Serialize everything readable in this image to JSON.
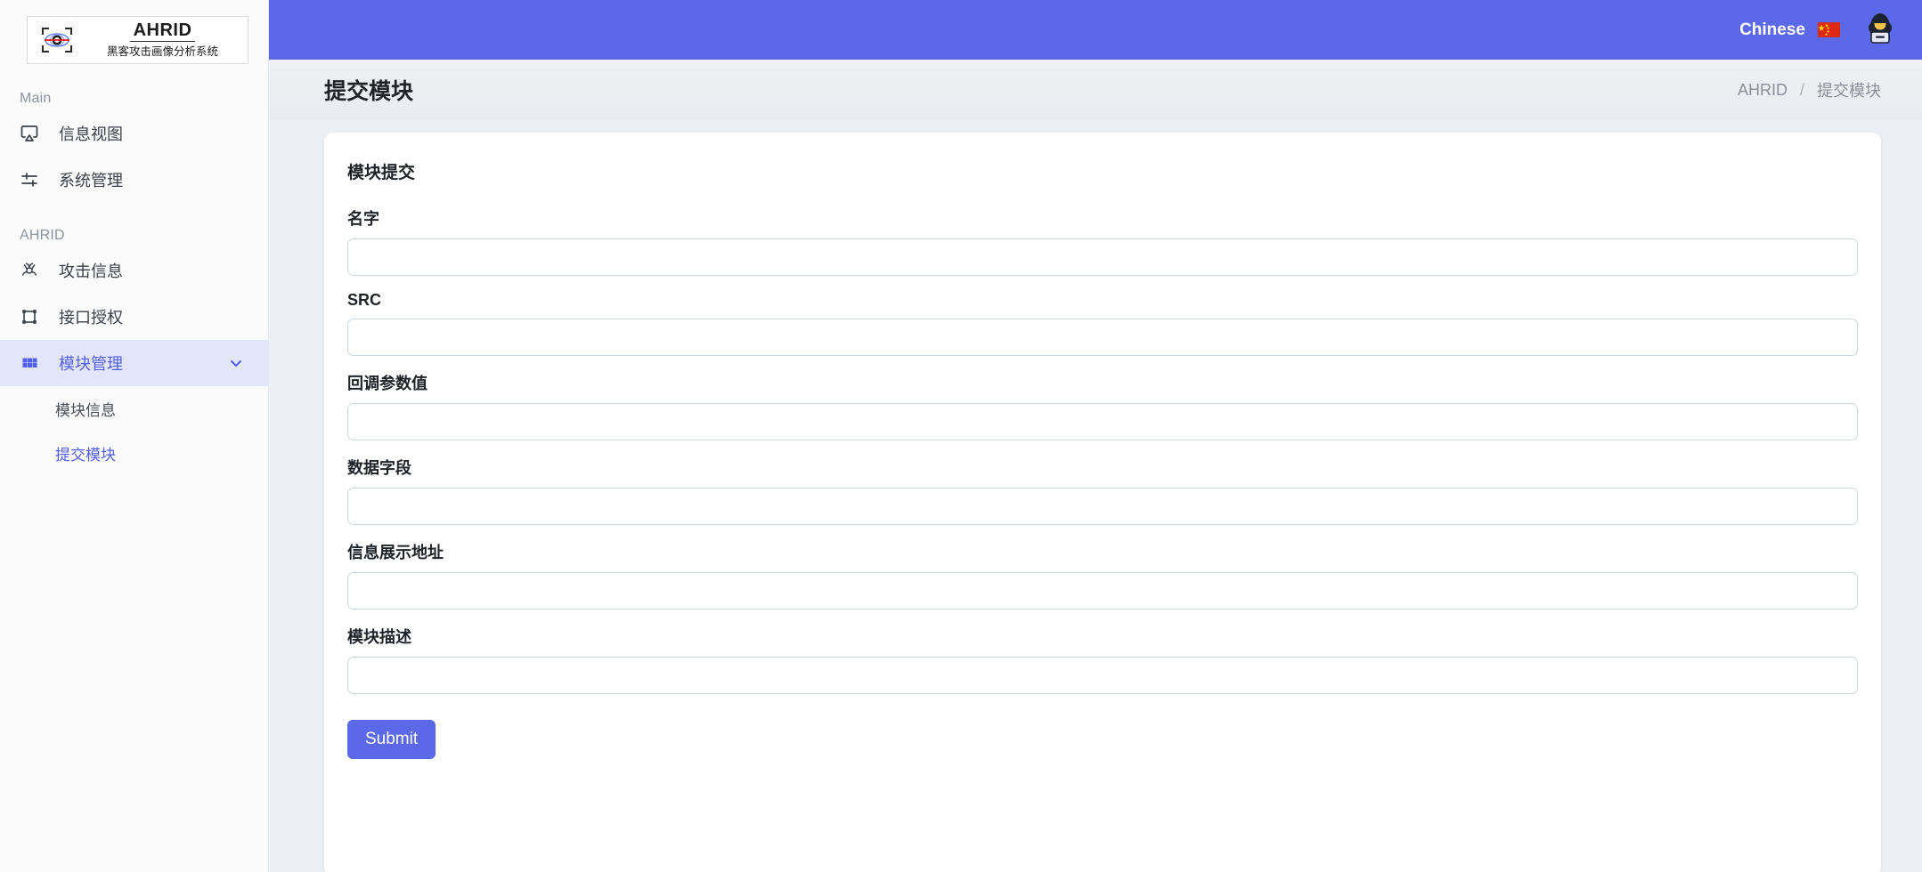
{
  "brand": {
    "title": "AHRID",
    "subtitle": "黑客攻击画像分析系统",
    "logo_icon": "crosshair-eye-icon"
  },
  "topbar": {
    "language_label": "Chinese",
    "flag_icon": "china-flag-icon",
    "avatar_icon": "hacker-avatar-icon",
    "background_color": "#5b68e8"
  },
  "sidebar": {
    "sections": [
      {
        "label": "Main"
      },
      {
        "label": "AHRID"
      }
    ],
    "items": [
      {
        "label": "信息视图",
        "icon": "monitor-airplay-icon",
        "active": false
      },
      {
        "label": "系统管理",
        "icon": "sliders-tune-icon",
        "active": false
      },
      {
        "label": "攻击信息",
        "icon": "biohazard-icon",
        "active": false
      },
      {
        "label": "接口授权",
        "icon": "crop-frame-icon",
        "active": false
      },
      {
        "label": "模块管理",
        "icon": "grid-apps-icon",
        "active": true,
        "chevron": "chevron-down-icon"
      }
    ],
    "subitems": [
      {
        "label": "模块信息",
        "active": false
      },
      {
        "label": "提交模块",
        "active": true
      }
    ],
    "active_color": "#5160e6",
    "active_bg": "#e3e5fa"
  },
  "page": {
    "title": "提交模块",
    "breadcrumb": {
      "root": "AHRID",
      "separator": "/",
      "current": "提交模块"
    }
  },
  "form": {
    "card_title": "模块提交",
    "fields": [
      {
        "label": "名字",
        "value": "",
        "placeholder": ""
      },
      {
        "label": "SRC",
        "value": "",
        "placeholder": ""
      },
      {
        "label": "回调参数值",
        "value": "",
        "placeholder": ""
      },
      {
        "label": "数据字段",
        "value": "",
        "placeholder": ""
      },
      {
        "label": "信息展示地址",
        "value": "",
        "placeholder": ""
      },
      {
        "label": "模块描述",
        "value": "",
        "placeholder": ""
      }
    ],
    "submit_label": "Submit",
    "submit_color": "#5b68e8"
  }
}
